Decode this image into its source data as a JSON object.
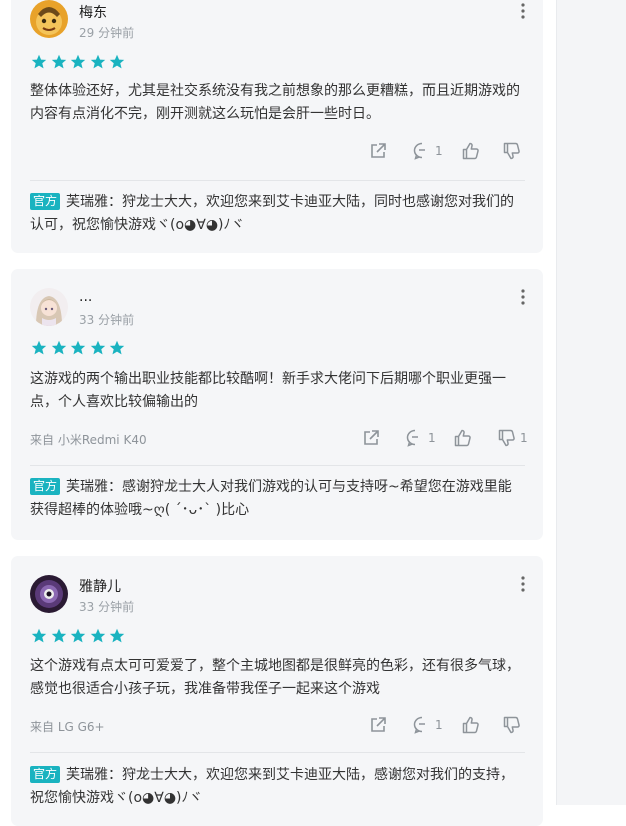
{
  "colors": {
    "accent": "#1ab3c0",
    "star": "#1ab3c0",
    "card_bg": "#f5f6f8"
  },
  "reviews": [
    {
      "username": "梅东",
      "time": "29 分钟前",
      "stars": 5,
      "text": "整体体验还好，尤其是社交系统没有我之前想象的那么更糟糕，而且近期游戏的内容有点消化不完，刚开测就这么玩怕是会肝一些时日。",
      "device": "",
      "comment_count": "1",
      "like_count": "",
      "dislike_count": "",
      "reply": {
        "badge": "官方",
        "author": "芙瑞雅",
        "text": "芙瑞雅：狩龙士大大，欢迎您来到艾卡迪亚大陆，同时也感谢您对我们的认可，祝您愉快游戏ヾ(o◕∀◕)ﾉヾ"
      }
    },
    {
      "username": "...",
      "time": "33 分钟前",
      "stars": 5,
      "text": "这游戏的两个输出职业技能都比较酷啊！新手求大佬问下后期哪个职业更强一点，个人喜欢比较偏输出的",
      "device": "来自 小米Redmi K40",
      "comment_count": "1",
      "like_count": "",
      "dislike_count": "1",
      "reply": {
        "badge": "官方",
        "author": "芙瑞雅",
        "text": "芙瑞雅：感谢狩龙士大人对我们游戏的认可与支持呀~希望您在游戏里能获得超棒的体验哦~ღ( ´･ᴗ･` )比心"
      }
    },
    {
      "username": "雅静儿",
      "time": "33 分钟前",
      "stars": 5,
      "text": "这个游戏有点太可可爱爱了，整个主城地图都是很鲜亮的色彩，还有很多气球，感觉也很适合小孩子玩，我准备带我侄子一起来这个游戏",
      "device": "来自 LG G6+",
      "comment_count": "1",
      "like_count": "",
      "dislike_count": "",
      "reply": {
        "badge": "官方",
        "author": "芙瑞雅",
        "text": "芙瑞雅：狩龙士大大，欢迎您来到艾卡迪亚大陆，感谢您对我们的支持，祝您愉快游戏ヾ(o◕∀◕)ﾉヾ"
      }
    }
  ]
}
